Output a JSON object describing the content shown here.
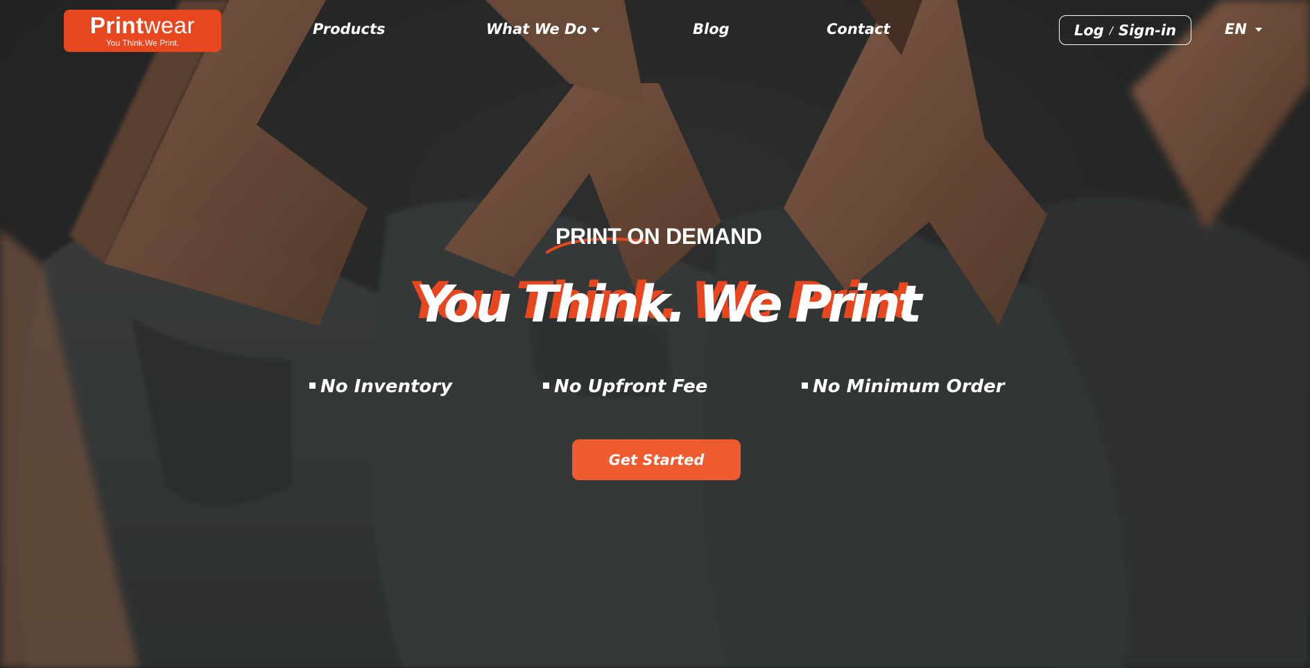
{
  "brand": {
    "name_bold": "Print",
    "name_light": "wear",
    "tagline": "You Think.We Print.",
    "color": "#e8461f"
  },
  "nav": {
    "items": [
      {
        "label": "Products",
        "has_dropdown": false
      },
      {
        "label": "What We Do",
        "has_dropdown": true
      },
      {
        "label": "Blog",
        "has_dropdown": false
      },
      {
        "label": "Contact",
        "has_dropdown": false
      }
    ],
    "login": {
      "left": "Log",
      "sep": "/",
      "right": "Sign-in"
    },
    "language": "EN"
  },
  "hero": {
    "eyebrow": "PRINT ON DEMAND",
    "headline": "You Think. We Print",
    "features": [
      "No Inventory",
      "No Upfront Fee",
      "No Minimum Order"
    ],
    "cta_label": "Get Started",
    "cta_color": "#ef5a2e"
  },
  "background": {
    "description_icon": "hanging-tshirts-photo"
  }
}
